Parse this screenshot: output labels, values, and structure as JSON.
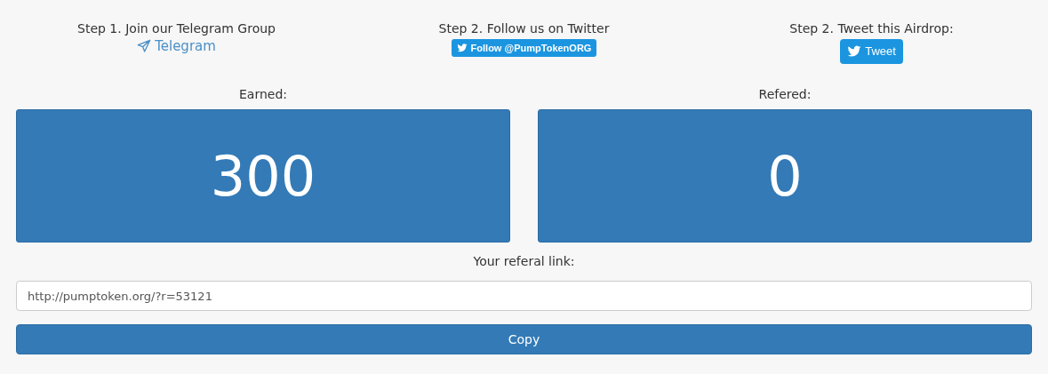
{
  "steps": [
    {
      "title": "Step 1. Join our Telegram Group",
      "action": {
        "kind": "link",
        "label": "Telegram"
      }
    },
    {
      "title": "Step 2. Follow us on Twitter",
      "action": {
        "kind": "follow",
        "label": "Follow @PumpTokenORG"
      }
    },
    {
      "title": "Step 2. Tweet this Airdrop:",
      "action": {
        "kind": "tweet",
        "label": "Tweet"
      }
    }
  ],
  "stats": [
    {
      "label": "Earned:",
      "value": "300"
    },
    {
      "label": "Refered:",
      "value": "0"
    }
  ],
  "referral": {
    "label": "Your referal link:",
    "value": "http://pumptoken.org/?r=53121"
  },
  "copy_button": "Copy"
}
